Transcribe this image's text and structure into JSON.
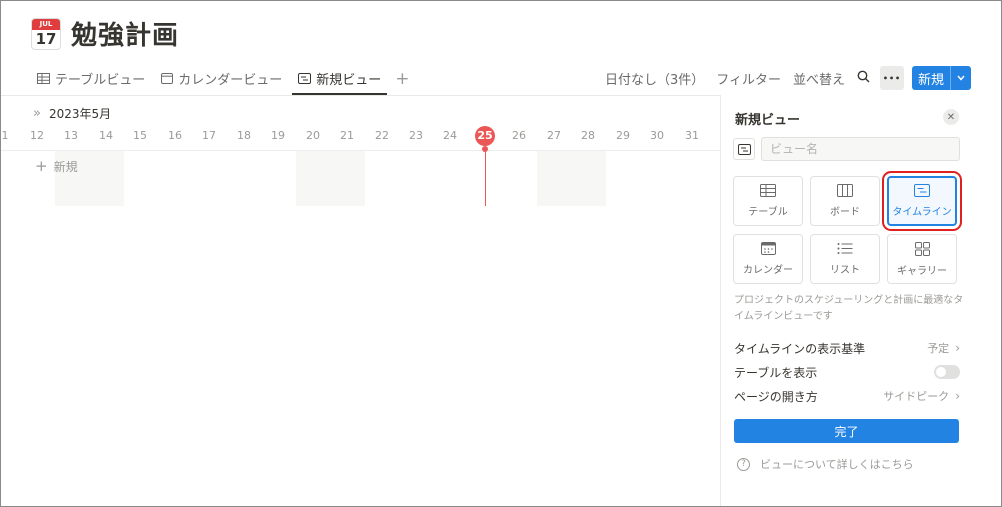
{
  "page": {
    "icon_month": "JUL",
    "icon_day": "17",
    "title": "勉強計画"
  },
  "tabs": [
    {
      "label": "テーブルビュー",
      "icon": "table-icon"
    },
    {
      "label": "カレンダービュー",
      "icon": "calendar-icon"
    },
    {
      "label": "新規ビュー",
      "icon": "timeline-icon",
      "active": true
    }
  ],
  "toolbar": {
    "no_date": "日付なし（3件）",
    "filter": "フィルター",
    "sort": "並べ替え",
    "more": "•••",
    "new": "新規"
  },
  "timeline": {
    "month_label": "2023年5月",
    "days": [
      "1",
      "12",
      "13",
      "14",
      "15",
      "16",
      "17",
      "18",
      "19",
      "20",
      "21",
      "22",
      "23",
      "24",
      "25",
      "26",
      "27",
      "28",
      "29",
      "30",
      "31"
    ],
    "today": "25",
    "add_label": "新規"
  },
  "panel": {
    "title": "新規ビュー",
    "name_placeholder": "ビュー名",
    "layouts": [
      {
        "label": "テーブル",
        "icon": "table-icon"
      },
      {
        "label": "ボード",
        "icon": "board-icon"
      },
      {
        "label": "タイムライン",
        "icon": "timeline-icon",
        "selected": true
      },
      {
        "label": "カレンダー",
        "icon": "calendar-icon"
      },
      {
        "label": "リスト",
        "icon": "list-icon"
      },
      {
        "label": "ギャラリー",
        "icon": "gallery-icon"
      }
    ],
    "description": "プロジェクトのスケジューリングと計画に最適なタイムラインビューです",
    "settings": {
      "basis_label": "タイムラインの表示基準",
      "basis_value": "予定",
      "show_table_label": "テーブルを表示",
      "open_pages_label": "ページの開き方",
      "open_pages_value": "サイドピーク"
    },
    "done": "完了",
    "help": "ビューについて詳しくはこちら"
  },
  "colors": {
    "accent": "#2383e2",
    "today": "#eb5757",
    "highlight_box": "#e02020"
  }
}
